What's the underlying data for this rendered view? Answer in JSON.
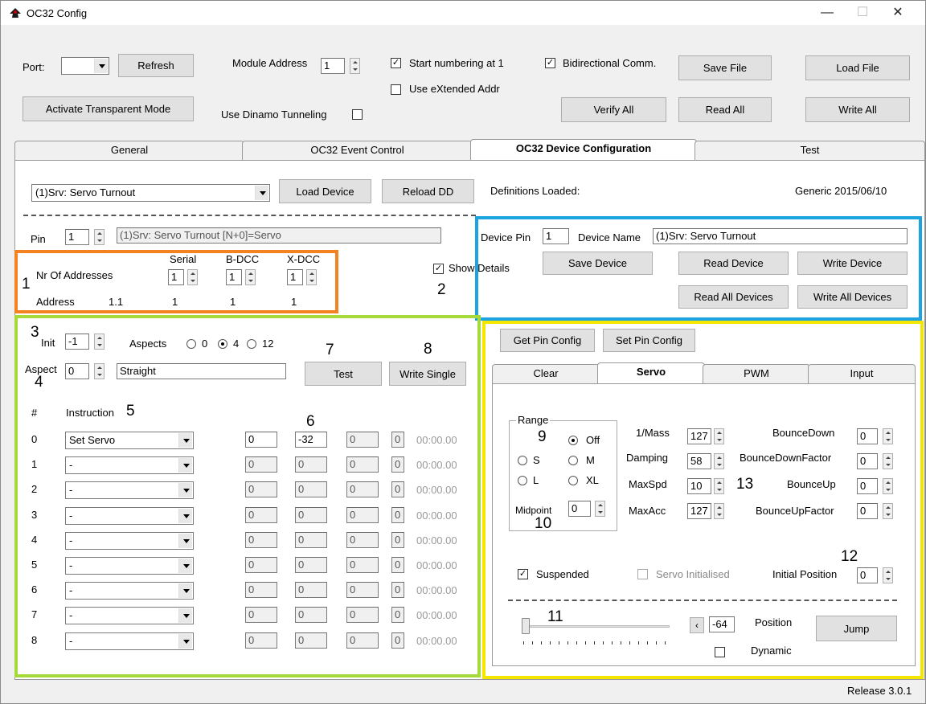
{
  "window": {
    "title": "OC32 Config",
    "minimize": "—",
    "maximize": "☐",
    "close": "✕"
  },
  "toolbar": {
    "port_label": "Port:",
    "port_value": "",
    "refresh": "Refresh",
    "module_address_label": "Module Address",
    "module_address": "1",
    "start_numbering": "Start numbering at 1",
    "start_numbering_checked": true,
    "use_extended": "Use eXtended Addr",
    "use_extended_checked": false,
    "bidirectional": "Bidirectional Comm.",
    "bidirectional_checked": true,
    "save_file": "Save File",
    "load_file": "Load File",
    "activate_transparent": "Activate Transparent Mode",
    "use_dinamo": "Use Dinamo Tunneling",
    "use_dinamo_checked": false,
    "verify_all": "Verify All",
    "read_all": "Read All",
    "write_all": "Write All"
  },
  "tabs": [
    "General",
    "OC32 Event Control",
    "OC32 Device Configuration",
    "Test"
  ],
  "device": {
    "selected": "(1)Srv: Servo Turnout",
    "load_device": "Load Device",
    "reload_dd": "Reload DD",
    "definitions_label": "Definitions Loaded:",
    "definitions_value": "Generic 2015/06/10",
    "pin_label": "Pin",
    "pin_value": "1",
    "pin_desc": "(1)Srv: Servo Turnout [N+0]=Servo",
    "nr_addresses_label": "Nr Of Addresses",
    "serial_label": "Serial",
    "bdcc_label": "B-DCC",
    "xdcc_label": "X-DCC",
    "serial_value": "1",
    "bdcc_value": "1",
    "xdcc_value": "1",
    "address_label": "Address",
    "address_main": "1.1",
    "address_serial": "1",
    "address_bdcc": "1",
    "address_xdcc": "1",
    "show_details": "Show Details",
    "show_details_checked": true,
    "device_pin_label": "Device Pin",
    "device_pin": "1",
    "device_name_label": "Device Name",
    "device_name": "(1)Srv: Servo Turnout",
    "save_device": "Save Device",
    "read_device": "Read Device",
    "write_device": "Write Device",
    "read_all_devices": "Read All Devices",
    "write_all_devices": "Write All Devices"
  },
  "aspects": {
    "init_label": "Init",
    "init_value": "-1",
    "aspects_label": "Aspects",
    "opt0": "0",
    "opt4": "4",
    "opt12": "12",
    "selected": "4",
    "aspect_label": "Aspect",
    "aspect_value": "0",
    "aspect_name": "Straight",
    "test": "Test",
    "write_single": "Write Single",
    "hash": "#",
    "instruction": "Instruction"
  },
  "instructions": [
    {
      "n": "0",
      "instr": "Set Servo",
      "a": "0",
      "b": "-32",
      "c": "0",
      "d": "0",
      "t": "00:00.00"
    },
    {
      "n": "1",
      "instr": "-",
      "a": "0",
      "b": "0",
      "c": "0",
      "d": "0",
      "t": "00:00.00"
    },
    {
      "n": "2",
      "instr": "-",
      "a": "0",
      "b": "0",
      "c": "0",
      "d": "0",
      "t": "00:00.00"
    },
    {
      "n": "3",
      "instr": "-",
      "a": "0",
      "b": "0",
      "c": "0",
      "d": "0",
      "t": "00:00.00"
    },
    {
      "n": "4",
      "instr": "-",
      "a": "0",
      "b": "0",
      "c": "0",
      "d": "0",
      "t": "00:00.00"
    },
    {
      "n": "5",
      "instr": "-",
      "a": "0",
      "b": "0",
      "c": "0",
      "d": "0",
      "t": "00:00.00"
    },
    {
      "n": "6",
      "instr": "-",
      "a": "0",
      "b": "0",
      "c": "0",
      "d": "0",
      "t": "00:00.00"
    },
    {
      "n": "7",
      "instr": "-",
      "a": "0",
      "b": "0",
      "c": "0",
      "d": "0",
      "t": "00:00.00"
    },
    {
      "n": "8",
      "instr": "-",
      "a": "0",
      "b": "0",
      "c": "0",
      "d": "0",
      "t": "00:00.00"
    }
  ],
  "pinconfig": {
    "get": "Get Pin Config",
    "set": "Set Pin Config",
    "subtabs": [
      "Clear",
      "Servo",
      "PWM",
      "Input"
    ],
    "range_label": "Range",
    "off": "Off",
    "s": "S",
    "m": "M",
    "l": "L",
    "xl": "XL",
    "range_selected": "Off",
    "midpoint_label": "Midpoint",
    "midpoint": "0",
    "mass_label": "1/Mass",
    "mass": "127",
    "damping_label": "Damping",
    "damping": "58",
    "maxspd_label": "MaxSpd",
    "maxspd": "10",
    "maxacc_label": "MaxAcc",
    "maxacc": "127",
    "bouncedown_label": "BounceDown",
    "bouncedown": "0",
    "bouncedownfactor_label": "BounceDownFactor",
    "bouncedownfactor": "0",
    "bounceup_label": "BounceUp",
    "bounceup": "0",
    "bounceupfactor_label": "BounceUpFactor",
    "bounceupfactor": "0",
    "suspended": "Suspended",
    "suspended_checked": true,
    "servo_initialised": "Servo Initialised",
    "servo_initialised_checked": false,
    "initial_position_label": "Initial Position",
    "initial_position": "0",
    "position_value": "-64",
    "position_label": "Position",
    "jump": "Jump",
    "dynamic": "Dynamic",
    "dynamic_checked": false,
    "slider_fraction": 0.0
  },
  "annotations": [
    "1",
    "2",
    "3",
    "4",
    "5",
    "6",
    "7",
    "8",
    "9",
    "10",
    "11",
    "12",
    "13"
  ],
  "highlight_colors": {
    "orange": "#f58220",
    "blue": "#1ca4e0",
    "green": "#a6d93a",
    "yellow": "#f5e600"
  },
  "status": {
    "release": "Release 3.0.1"
  }
}
